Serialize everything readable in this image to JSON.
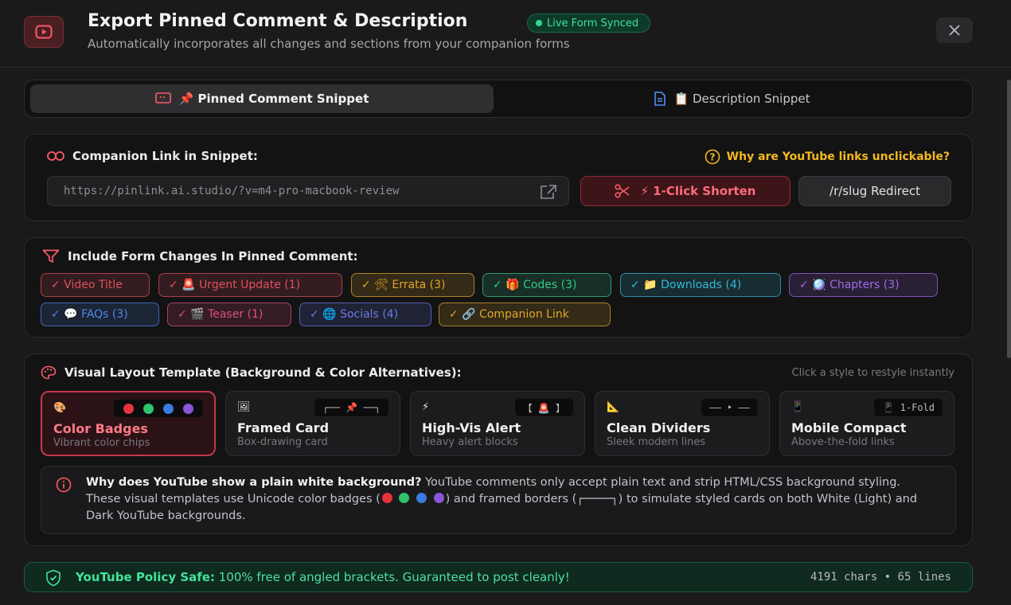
{
  "header": {
    "title": "Export Pinned Comment & Description",
    "live_badge": "Live Form Synced",
    "subtitle": "Automatically incorporates all changes and sections from your companion forms",
    "close_label": "✕"
  },
  "tabs": [
    {
      "label": "📌 Pinned Comment Snippet",
      "active": true
    },
    {
      "label": "📋 Description Snippet",
      "active": false
    }
  ],
  "companion": {
    "title": "Companion Link in Snippet:",
    "why_link": "Why are YouTube links unclickable?",
    "url_value": "https://pinlink.ai.studio/?v=m4-pro-macbook-review",
    "shorten_label": "⚡ 1-Click Shorten",
    "redirect_label": "/r/slug Redirect"
  },
  "form_changes": {
    "title": "Include Form Changes In Pinned Comment:",
    "chips": [
      {
        "label": "✓ Video Title",
        "color": "#e0505e"
      },
      {
        "label": "✓ 🚨 Urgent Update (1)",
        "color": "#e0505e"
      },
      {
        "label": "✓ 🛠 Errata (3)",
        "color": "#e2a62a"
      },
      {
        "label": "✓ 🎁 Codes (3)",
        "color": "#34c98a"
      },
      {
        "label": "✓ 📁 Downloads (4)",
        "color": "#34b8d6"
      },
      {
        "label": "✓ 🪩 Chapters (3)",
        "color": "#a06ae8"
      },
      {
        "label": "✓ 💬 FAQs (3)",
        "color": "#4f86ea"
      },
      {
        "label": "✓ 🎬 Teaser (1)",
        "color": "#e0507e"
      },
      {
        "label": "✓ 🌐 Socials (4)",
        "color": "#6a7ae8"
      },
      {
        "label": "✓ 🔗 Companion Link",
        "color": "#e2a62a"
      }
    ]
  },
  "templates": {
    "title": "Visual Layout Template (Background & Color Alternatives):",
    "hint": "Click a style to restyle instantly",
    "items": [
      {
        "icon": "🎨",
        "name": "Color Badges",
        "desc": "Vibrant color chips",
        "active": true
      },
      {
        "icon": "🖼",
        "name": "Framed Card",
        "desc": "Box-drawing card",
        "preview": "┌── 📌 ──┐",
        "active": false
      },
      {
        "icon": "⚡",
        "name": "High-Vis Alert",
        "desc": "Heavy alert blocks",
        "preview": "【 🚨 】",
        "active": false
      },
      {
        "icon": "📐",
        "name": "Clean Dividers",
        "desc": "Sleek modern lines",
        "preview": "—— ‣ ——",
        "active": false
      },
      {
        "icon": "📱",
        "name": "Mobile Compact",
        "desc": "Above-the-fold links",
        "preview": "📱 1-Fold",
        "active": false
      }
    ]
  },
  "info": {
    "question": "Why does YouTube show a plain white background?",
    "text1": " YouTube comments only accept plain text and strip HTML/CSS background styling. These visual templates use Unicode color badges (",
    "text2": ") and framed borders (",
    "frame_glyph": "┌────┐",
    "text3": ") to simulate styled cards on both White (Light) and Dark YouTube backgrounds."
  },
  "footer": {
    "label": "YouTube Policy Safe:",
    "message": " 100% free of angled brackets. Guaranteed to post cleanly!",
    "stats": "4191 chars • 65 lines"
  }
}
